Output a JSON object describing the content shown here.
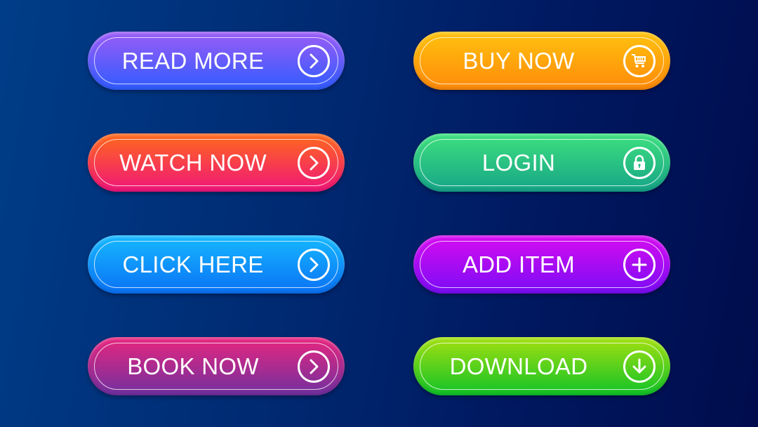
{
  "buttons": [
    {
      "label": "READ MORE",
      "icon": "chevron-right-circle-icon",
      "colors": {
        "top": "#9b5cf6",
        "bottom": "#2f5cff"
      }
    },
    {
      "label": "BUY NOW",
      "icon": "shopping-cart-icon",
      "colors": {
        "top": "#ffc20e",
        "bottom": "#ff8a0a"
      }
    },
    {
      "label": "WATCH NOW",
      "icon": "chevron-right-circle-icon",
      "colors": {
        "top": "#ff6a1a",
        "bottom": "#f0157a"
      }
    },
    {
      "label": "LOGIN",
      "icon": "lock-icon",
      "colors": {
        "top": "#3ee07e",
        "bottom": "#16a488"
      }
    },
    {
      "label": "CLICK HERE",
      "icon": "chevron-right-circle-icon",
      "colors": {
        "top": "#16b8ff",
        "bottom": "#0a72f5"
      }
    },
    {
      "label": "ADD ITEM",
      "icon": "plus-circle-icon",
      "colors": {
        "top": "#d60cf0",
        "bottom": "#7a0cf5"
      }
    },
    {
      "label": "BOOK NOW",
      "icon": "chevron-right-circle-icon",
      "colors": {
        "top": "#e8267e",
        "bottom": "#7030a0"
      }
    },
    {
      "label": "DOWNLOAD",
      "icon": "download-arrow-icon",
      "colors": {
        "top": "#a4e010",
        "bottom": "#10c228"
      }
    }
  ]
}
